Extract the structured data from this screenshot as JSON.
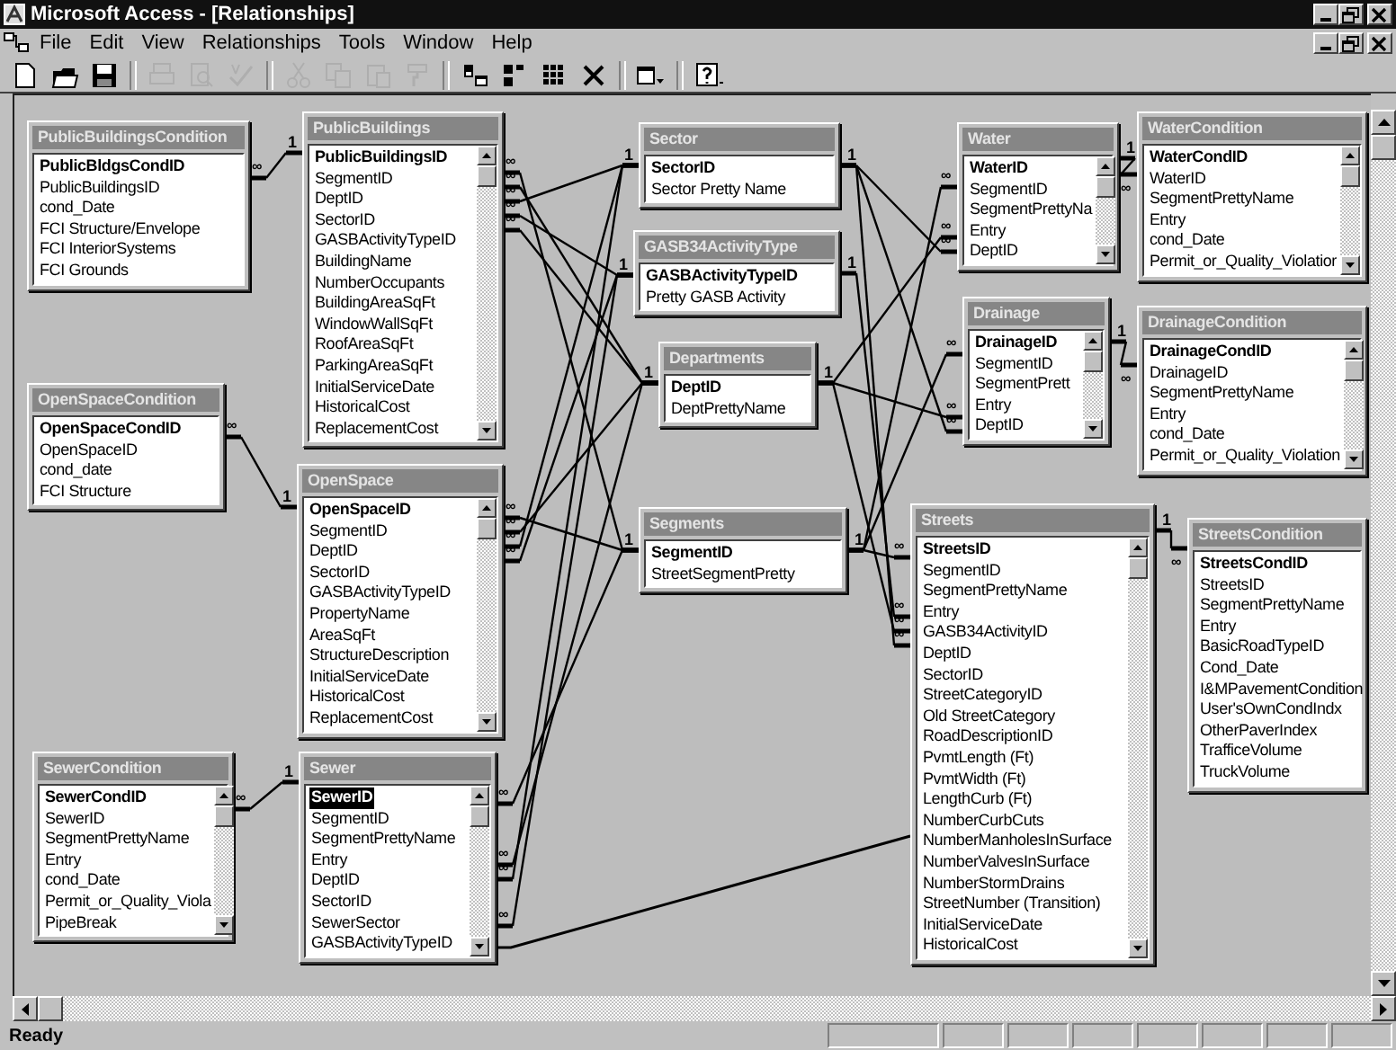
{
  "window": {
    "title": "Microsoft Access - [Relationships]"
  },
  "menu": [
    "File",
    "Edit",
    "View",
    "Relationships",
    "Tools",
    "Window",
    "Help"
  ],
  "toolbar": [
    [
      {
        "kind": "new",
        "disabled": false
      },
      {
        "kind": "open",
        "disabled": false
      },
      {
        "kind": "save",
        "disabled": false
      }
    ],
    [
      {
        "kind": "print",
        "disabled": true
      },
      {
        "kind": "preview",
        "disabled": true
      },
      {
        "kind": "spelling",
        "disabled": true
      }
    ],
    [
      {
        "kind": "cut",
        "disabled": true
      },
      {
        "kind": "copy",
        "disabled": true
      },
      {
        "kind": "paste",
        "disabled": true
      },
      {
        "kind": "format",
        "disabled": true
      }
    ],
    [
      {
        "kind": "show-table",
        "disabled": false
      },
      {
        "kind": "show-direct",
        "disabled": false
      },
      {
        "kind": "show-all",
        "disabled": false
      },
      {
        "kind": "delete",
        "disabled": false
      }
    ],
    [
      {
        "kind": "new-object",
        "disabled": false
      }
    ],
    [
      {
        "kind": "help",
        "disabled": false
      }
    ]
  ],
  "tables": [
    {
      "title": "PublicBuildingsCondition",
      "key_field": "PublicBldgsCondID",
      "key_selected": false,
      "scrollable": false,
      "fields": [
        "PublicBuildingsID",
        "cond_Date",
        "FCI Structure/Envelope",
        "FCI InteriorSystems",
        "FCI Grounds"
      ]
    },
    {
      "title": "PublicBuildings",
      "key_field": "PublicBuildingsID",
      "key_selected": false,
      "scrollable": true,
      "fields": [
        "SegmentID",
        "DeptID",
        "SectorID",
        "GASBActivityTypeID",
        "BuildingName",
        "NumberOccupants",
        "BuildingAreaSqFt",
        "WindowWallSqFt",
        "RoofAreaSqFt",
        "ParkingAreaSqFt",
        "InitialServiceDate",
        "HistoricalCost",
        "ReplacementCost"
      ]
    },
    {
      "title": "Sector",
      "key_field": "SectorID",
      "key_selected": false,
      "scrollable": false,
      "fields": [
        "Sector Pretty Name"
      ]
    },
    {
      "title": "GASB34ActivityType",
      "key_field": "GASBActivityTypeID",
      "key_selected": false,
      "scrollable": false,
      "fields": [
        "Pretty GASB Activity"
      ]
    },
    {
      "title": "Departments",
      "key_field": "DeptID",
      "key_selected": false,
      "scrollable": false,
      "fields": [
        "DeptPrettyName"
      ]
    },
    {
      "title": "Water",
      "key_field": "WaterID",
      "key_selected": false,
      "scrollable": true,
      "fields": [
        "SegmentID",
        "SegmentPrettyNa",
        "Entry",
        "DeptID"
      ]
    },
    {
      "title": "WaterCondition",
      "key_field": "WaterCondID",
      "key_selected": false,
      "scrollable": true,
      "fields": [
        "WaterID",
        "SegmentPrettyName",
        "Entry",
        "cond_Date",
        "Permit_or_Quality_Violatior"
      ]
    },
    {
      "title": "Drainage",
      "key_field": "DrainageID",
      "key_selected": false,
      "scrollable": true,
      "fields": [
        "SegmentID",
        "SegmentPrett",
        "Entry",
        "DeptID"
      ]
    },
    {
      "title": "DrainageCondition",
      "key_field": "DrainageCondID",
      "key_selected": false,
      "scrollable": true,
      "fields": [
        "DrainageID",
        "SegmentPrettyName",
        "Entry",
        "cond_Date",
        "Permit_or_Quality_Violation"
      ]
    },
    {
      "title": "OpenSpaceCondition",
      "key_field": "OpenSpaceCondID",
      "key_selected": false,
      "scrollable": false,
      "fields": [
        "OpenSpaceID",
        "cond_date",
        "FCI Structure"
      ]
    },
    {
      "title": "OpenSpace",
      "key_field": "OpenSpaceID",
      "key_selected": false,
      "scrollable": true,
      "fields": [
        "SegmentID",
        "DeptID",
        "SectorID",
        "GASBActivityTypeID",
        "PropertyName",
        "AreaSqFt",
        "StructureDescription",
        "InitialServiceDate",
        "HistoricalCost",
        "ReplacementCost"
      ]
    },
    {
      "title": "Segments",
      "key_field": "SegmentID",
      "key_selected": false,
      "scrollable": false,
      "fields": [
        "StreetSegmentPretty"
      ]
    },
    {
      "title": "Streets",
      "key_field": "StreetsID",
      "key_selected": false,
      "scrollable": true,
      "fields": [
        "SegmentID",
        "SegmentPrettyName",
        "Entry",
        "GASB34ActivityID",
        "DeptID",
        "SectorID",
        "StreetCategoryID",
        "Old StreetCategory",
        "RoadDescriptionID",
        "PvmtLength (Ft)",
        "PvmtWidth (Ft)",
        "LengthCurb (Ft)",
        "NumberCurbCuts",
        "NumberManholesInSurface",
        "NumberValvesInSurface",
        "NumberStormDrains",
        "StreetNumber (Transition)",
        "InitialServiceDate",
        "HistoricalCost"
      ]
    },
    {
      "title": "StreetsCondition",
      "key_field": "StreetsCondID",
      "key_selected": false,
      "scrollable": false,
      "fields": [
        "StreetsID",
        "SegmentPrettyName",
        "Entry",
        "BasicRoadTypeID",
        "Cond_Date",
        "I&MPavementCondition",
        "User'sOwnCondIndx",
        "OtherPaverIndex",
        "TrafficeVolume",
        "TruckVolume"
      ]
    },
    {
      "title": "SewerCondition",
      "key_field": "SewerCondID",
      "key_selected": false,
      "scrollable": true,
      "fields": [
        "SewerID",
        "SegmentPrettyName",
        "Entry",
        "cond_Date",
        "Permit_or_Quality_Viola",
        "PipeBreak"
      ]
    },
    {
      "title": "Sewer",
      "key_field": "SewerID",
      "key_selected": true,
      "scrollable": true,
      "fields": [
        "SegmentID",
        "SegmentPrettyName",
        "Entry",
        "DeptID",
        "SectorID",
        "SewerSector",
        "GASBActivityTypeID"
      ]
    }
  ],
  "one_marks": [
    "1",
    "1",
    "1",
    "1",
    "1",
    "1",
    "1",
    "1",
    "1",
    "1",
    "1",
    "1",
    "1",
    "1"
  ],
  "many_marks": [
    "∞",
    "∞",
    "∞",
    "∞",
    "∞",
    "∞",
    "∞",
    "∞",
    "∞",
    "∞",
    "∞",
    "∞",
    "∞",
    "∞",
    "∞",
    "∞",
    "∞",
    "∞",
    "∞",
    "∞",
    "∞",
    "∞",
    "∞",
    "∞",
    "∞",
    "∞",
    "∞",
    "∞",
    "∞"
  ],
  "status_bar": {
    "text": "Ready"
  }
}
